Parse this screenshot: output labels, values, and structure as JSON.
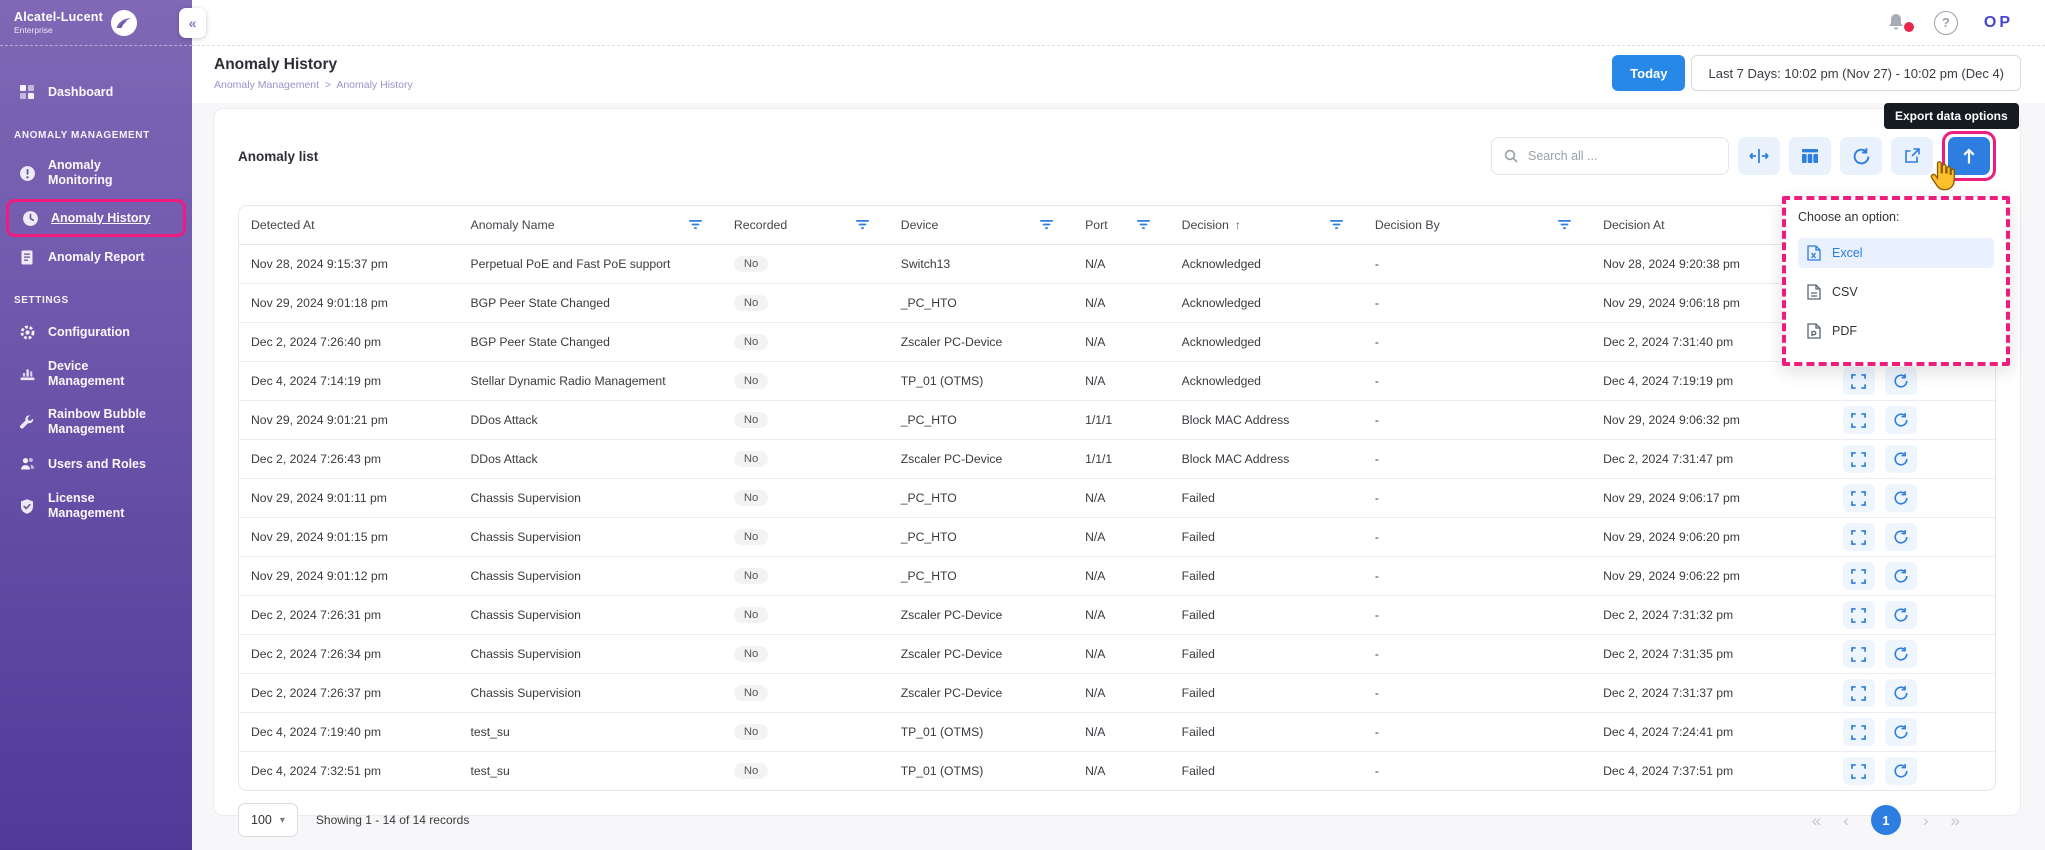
{
  "brand": {
    "name": "Alcatel-Lucent",
    "sub": "Enterprise"
  },
  "topbar": {
    "user_initials": "OP",
    "help_label": "?"
  },
  "sidebar": {
    "dashboard": {
      "label": "Dashboard",
      "icon": "dashboard-icon"
    },
    "sections": [
      {
        "title": "ANOMALY MANAGEMENT",
        "items": [
          {
            "label": "Anomaly Monitoring",
            "icon": "alert-icon",
            "active": false
          },
          {
            "label": "Anomaly History",
            "icon": "clock-icon",
            "active": true
          },
          {
            "label": "Anomaly Report",
            "icon": "report-icon",
            "active": false
          }
        ]
      },
      {
        "title": "SETTINGS",
        "items": [
          {
            "label": "Configuration",
            "icon": "gear-icon",
            "active": false
          },
          {
            "label": "Device Management",
            "icon": "device-icon",
            "active": false
          },
          {
            "label": "Rainbow Bubble Management",
            "icon": "wrench-icon",
            "active": false
          },
          {
            "label": "Users and Roles",
            "icon": "users-icon",
            "active": false
          },
          {
            "label": "License Management",
            "icon": "license-icon",
            "active": false
          }
        ]
      }
    ]
  },
  "page": {
    "title": "Anomaly History",
    "breadcrumb": {
      "parent": "Anomaly Management",
      "separator": ">",
      "current": "Anomaly History"
    },
    "today_button": "Today",
    "date_range": "Last 7 Days: 10:02 pm (Nov 27) - 10:02 pm (Dec 4)"
  },
  "card": {
    "title": "Anomaly list",
    "search_placeholder": "Search all ...",
    "export_tooltip": "Export data options",
    "export_menu": {
      "title": "Choose an option:",
      "options": [
        {
          "label": "Excel",
          "selected": true
        },
        {
          "label": "CSV",
          "selected": false
        },
        {
          "label": "PDF",
          "selected": false
        }
      ]
    }
  },
  "table": {
    "columns": [
      {
        "label": "Detected At",
        "filter": false,
        "sort": ""
      },
      {
        "label": "Anomaly Name",
        "filter": true,
        "sort": ""
      },
      {
        "label": "Recorded",
        "filter": true,
        "sort": ""
      },
      {
        "label": "Device",
        "filter": true,
        "sort": ""
      },
      {
        "label": "Port",
        "filter": true,
        "sort": ""
      },
      {
        "label": "Decision",
        "filter": true,
        "sort": "asc"
      },
      {
        "label": "Decision By",
        "filter": true,
        "sort": ""
      },
      {
        "label": "Decision At",
        "filter": true,
        "sort": ""
      },
      {
        "label": "",
        "filter": false,
        "sort": ""
      }
    ],
    "rows": [
      {
        "detected_at": "Nov 28, 2024 9:15:37 pm",
        "anomaly_name": "Perpetual PoE and Fast PoE support",
        "recorded": "No",
        "device": "Switch13",
        "port": "N/A",
        "decision": "Acknowledged",
        "decision_by": "-",
        "decision_at": "Nov 28, 2024 9:20:38 pm"
      },
      {
        "detected_at": "Nov 29, 2024 9:01:18 pm",
        "anomaly_name": "BGP Peer State Changed",
        "recorded": "No",
        "device": "_PC_HTO",
        "port": "N/A",
        "decision": "Acknowledged",
        "decision_by": "-",
        "decision_at": "Nov 29, 2024 9:06:18 pm"
      },
      {
        "detected_at": "Dec 2, 2024 7:26:40 pm",
        "anomaly_name": "BGP Peer State Changed",
        "recorded": "No",
        "device": "Zscaler PC-Device",
        "port": "N/A",
        "decision": "Acknowledged",
        "decision_by": "-",
        "decision_at": "Dec 2, 2024 7:31:40 pm"
      },
      {
        "detected_at": "Dec 4, 2024 7:14:19 pm",
        "anomaly_name": "Stellar Dynamic Radio Management",
        "recorded": "No",
        "device": "TP_01 (OTMS)",
        "port": "N/A",
        "decision": "Acknowledged",
        "decision_by": "-",
        "decision_at": "Dec 4, 2024 7:19:19 pm"
      },
      {
        "detected_at": "Nov 29, 2024 9:01:21 pm",
        "anomaly_name": "DDos Attack",
        "recorded": "No",
        "device": "_PC_HTO",
        "port": "1/1/1",
        "decision": "Block MAC Address",
        "decision_by": "-",
        "decision_at": "Nov 29, 2024 9:06:32 pm"
      },
      {
        "detected_at": "Dec 2, 2024 7:26:43 pm",
        "anomaly_name": "DDos Attack",
        "recorded": "No",
        "device": "Zscaler PC-Device",
        "port": "1/1/1",
        "decision": "Block MAC Address",
        "decision_by": "-",
        "decision_at": "Dec 2, 2024 7:31:47 pm"
      },
      {
        "detected_at": "Nov 29, 2024 9:01:11 pm",
        "anomaly_name": "Chassis Supervision",
        "recorded": "No",
        "device": "_PC_HTO",
        "port": "N/A",
        "decision": "Failed",
        "decision_by": "-",
        "decision_at": "Nov 29, 2024 9:06:17 pm"
      },
      {
        "detected_at": "Nov 29, 2024 9:01:15 pm",
        "anomaly_name": "Chassis Supervision",
        "recorded": "No",
        "device": "_PC_HTO",
        "port": "N/A",
        "decision": "Failed",
        "decision_by": "-",
        "decision_at": "Nov 29, 2024 9:06:20 pm"
      },
      {
        "detected_at": "Nov 29, 2024 9:01:12 pm",
        "anomaly_name": "Chassis Supervision",
        "recorded": "No",
        "device": "_PC_HTO",
        "port": "N/A",
        "decision": "Failed",
        "decision_by": "-",
        "decision_at": "Nov 29, 2024 9:06:22 pm"
      },
      {
        "detected_at": "Dec 2, 2024 7:26:31 pm",
        "anomaly_name": "Chassis Supervision",
        "recorded": "No",
        "device": "Zscaler PC-Device",
        "port": "N/A",
        "decision": "Failed",
        "decision_by": "-",
        "decision_at": "Dec 2, 2024 7:31:32 pm"
      },
      {
        "detected_at": "Dec 2, 2024 7:26:34 pm",
        "anomaly_name": "Chassis Supervision",
        "recorded": "No",
        "device": "Zscaler PC-Device",
        "port": "N/A",
        "decision": "Failed",
        "decision_by": "-",
        "decision_at": "Dec 2, 2024 7:31:35 pm"
      },
      {
        "detected_at": "Dec 2, 2024 7:26:37 pm",
        "anomaly_name": "Chassis Supervision",
        "recorded": "No",
        "device": "Zscaler PC-Device",
        "port": "N/A",
        "decision": "Failed",
        "decision_by": "-",
        "decision_at": "Dec 2, 2024 7:31:37 pm"
      },
      {
        "detected_at": "Dec 4, 2024 7:19:40 pm",
        "anomaly_name": "test_su",
        "recorded": "No",
        "device": "TP_01 (OTMS)",
        "port": "N/A",
        "decision": "Failed",
        "decision_by": "-",
        "decision_at": "Dec 4, 2024 7:24:41 pm"
      },
      {
        "detected_at": "Dec 4, 2024 7:32:51 pm",
        "anomaly_name": "test_su",
        "recorded": "No",
        "device": "TP_01 (OTMS)",
        "port": "N/A",
        "decision": "Failed",
        "decision_by": "-",
        "decision_at": "Dec 4, 2024 7:37:51 pm"
      }
    ]
  },
  "footer": {
    "page_size": "100",
    "showing": "Showing 1 - 14 of 14 records",
    "page": "1"
  },
  "colors": {
    "accent_blue": "#2e7de0",
    "highlight_pink": "#ee1d7d",
    "sidebar_top": "#8068b6",
    "sidebar_bottom": "#4f3a9a",
    "tooltip_bg": "#161b22",
    "notification_red": "#e8274b",
    "today_blue": "#2788e8"
  }
}
